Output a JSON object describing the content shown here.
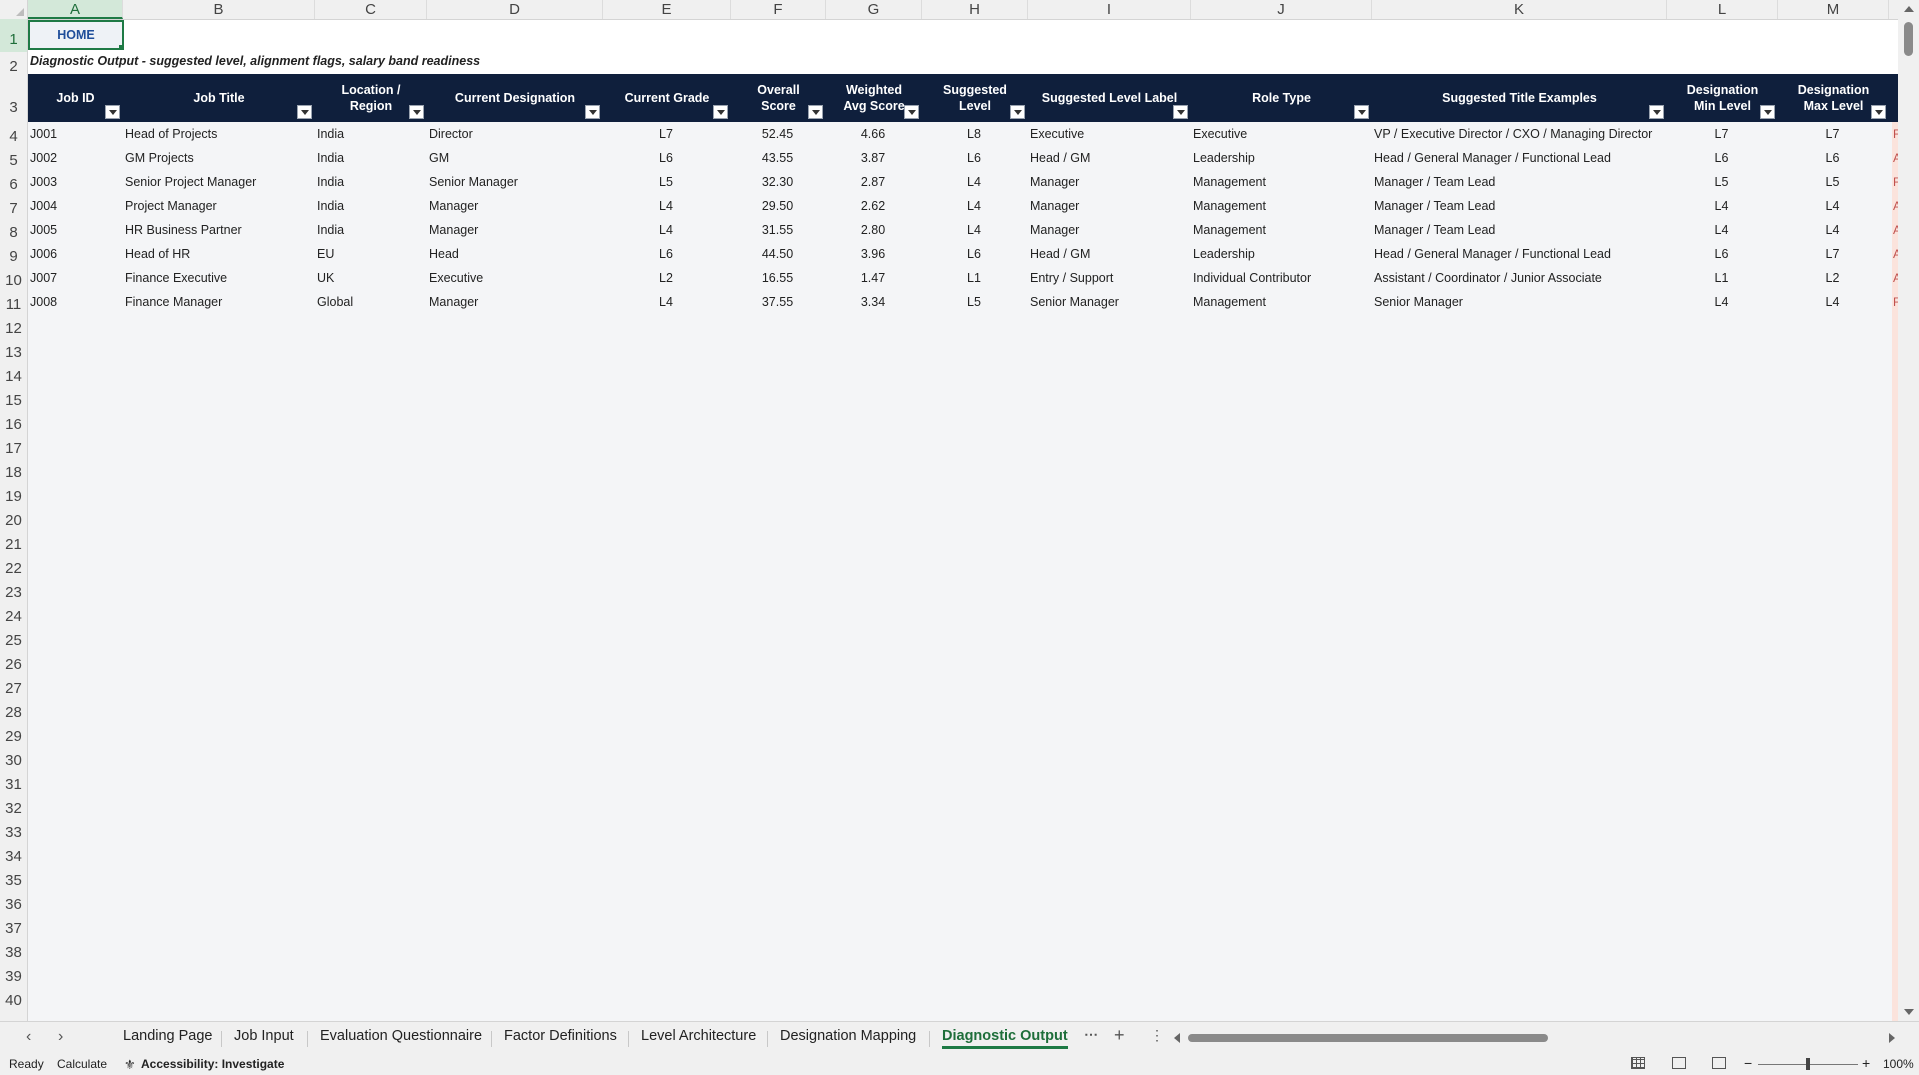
{
  "columns": [
    "A",
    "B",
    "C",
    "D",
    "E",
    "F",
    "G",
    "H",
    "I",
    "J",
    "K",
    "L",
    "M"
  ],
  "rows": [
    "1",
    "2",
    "3",
    "4",
    "5",
    "6",
    "7",
    "8",
    "9",
    "10",
    "11",
    "12",
    "13",
    "14",
    "15",
    "16",
    "17",
    "18",
    "19",
    "20",
    "21",
    "22",
    "23",
    "24",
    "25",
    "26",
    "27",
    "28",
    "29",
    "30",
    "31",
    "32",
    "33",
    "34",
    "35",
    "36",
    "37",
    "38",
    "39",
    "40"
  ],
  "home_button": "HOME",
  "subtitle": "Diagnostic Output - suggested level, alignment flags, salary band readiness",
  "headers": [
    "Job ID",
    "Job Title",
    "Location / Region",
    "Current Designation",
    "Current Grade",
    "Overall Score",
    "Weighted Avg Score",
    "Suggested Level",
    "Suggested Level Label",
    "Role Type",
    "Suggested Title Examples",
    "Designation Min Level",
    "Designation Max Level"
  ],
  "table_rows": [
    [
      "J001",
      "Head of Projects",
      "India",
      "Director",
      "L7",
      "52.45",
      "4.66",
      "L8",
      "Executive",
      "Executive",
      "VP / Executive Director / CXO / Managing Director",
      "L7",
      "L7"
    ],
    [
      "J002",
      "GM Projects",
      "India",
      "GM",
      "L6",
      "43.55",
      "3.87",
      "L6",
      "Head / GM",
      "Leadership",
      "Head / General Manager / Functional Lead",
      "L6",
      "L6"
    ],
    [
      "J003",
      "Senior Project Manager",
      "India",
      "Senior Manager",
      "L5",
      "32.30",
      "2.87",
      "L4",
      "Manager",
      "Management",
      "Manager / Team Lead",
      "L5",
      "L5"
    ],
    [
      "J004",
      "Project Manager",
      "India",
      "Manager",
      "L4",
      "29.50",
      "2.62",
      "L4",
      "Manager",
      "Management",
      "Manager / Team Lead",
      "L4",
      "L4"
    ],
    [
      "J005",
      "HR Business Partner",
      "India",
      "Manager",
      "L4",
      "31.55",
      "2.80",
      "L4",
      "Manager",
      "Management",
      "Manager / Team Lead",
      "L4",
      "L4"
    ],
    [
      "J006",
      "Head of HR",
      "EU",
      "Head",
      "L6",
      "44.50",
      "3.96",
      "L6",
      "Head / GM",
      "Leadership",
      "Head / General Manager / Functional Lead",
      "L6",
      "L7"
    ],
    [
      "J007",
      "Finance Executive",
      "UK",
      "Executive",
      "L2",
      "16.55",
      "1.47",
      "L1",
      "Entry / Support",
      "Individual Contributor",
      "Assistant / Coordinator / Junior Associate",
      "L1",
      "L2"
    ],
    [
      "J008",
      "Finance Manager",
      "Global",
      "Manager",
      "L4",
      "37.55",
      "3.34",
      "L5",
      "Senior Manager",
      "Management",
      "Senior Manager",
      "L4",
      "L4"
    ]
  ],
  "peek_column_letters": [
    "F",
    "A",
    "F",
    "A",
    "A",
    "A",
    "A",
    "F"
  ],
  "sheet_tabs": [
    "Landing Page",
    "Job Input",
    "Evaluation Questionnaire",
    "Factor Definitions",
    "Level Architecture",
    "Designation Mapping",
    "Diagnostic Output"
  ],
  "active_tab": "Diagnostic Output",
  "status": {
    "ready": "Ready",
    "calculate": "Calculate",
    "accessibility": "Accessibility: Investigate",
    "zoom": "100%"
  },
  "colors": {
    "header_fill": "#0f1f3c",
    "accent_green": "#1e7a45",
    "home_text": "#1f4e9a"
  }
}
